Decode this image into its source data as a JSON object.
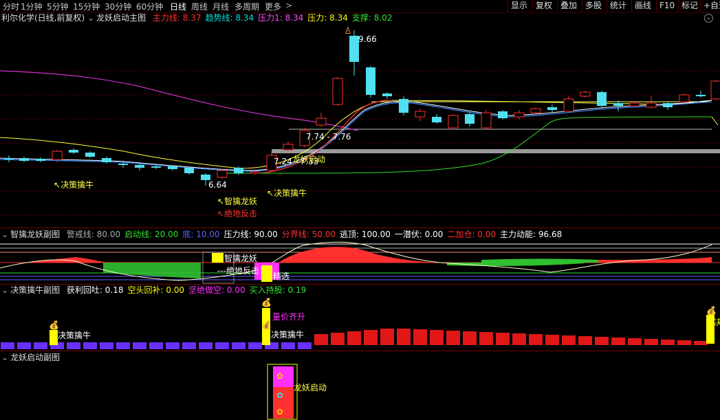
{
  "toolbar": {
    "periods": [
      "分时",
      "1分钟",
      "5分钟",
      "15分钟",
      "30分钟",
      "60分钟",
      "日线",
      "周线",
      "月线",
      "多周期",
      "更多"
    ],
    "active_period": "日线",
    "tools": [
      "显示",
      "复权",
      "叠加",
      "多股",
      "统计",
      "画线",
      "F10",
      "标记",
      "+自选"
    ]
  },
  "main": {
    "stock_title": "利尔化学(日线,前复权)",
    "indicator_name": "龙妖启动主图",
    "values": [
      {
        "label": "主力线:",
        "value": "8.37",
        "color": "#ff3030"
      },
      {
        "label": "趋势线:",
        "value": "8.34",
        "color": "#00e0e0"
      },
      {
        "label": "压力1:",
        "value": "8.34",
        "color": "#ff50ff"
      },
      {
        "label": "压力:",
        "value": "8.34",
        "color": "#ffff00"
      },
      {
        "label": "支撑:",
        "value": "8.02",
        "color": "#30e030"
      }
    ],
    "annotations": {
      "high": "9.66",
      "low": "6.64",
      "range": "7.74 - 7.76",
      "price_pair": "7.24 - 7.33",
      "longyao_qidong": "龙妖启动",
      "juece_1": "决策擒牛",
      "juece_2": "决策擒牛",
      "zhiqin": "智擒龙妖",
      "juedi": "绝地反击"
    }
  },
  "sub1": {
    "name": "智擒龙妖副图",
    "values": [
      {
        "label": "警戒线:",
        "value": "80.00",
        "color": "#aaaaaa"
      },
      {
        "label": "启动线:",
        "value": "20.00",
        "color": "#30e030"
      },
      {
        "label": "底:",
        "value": "10.00",
        "color": "#6060ff"
      },
      {
        "label": "压力线:",
        "value": "90.00",
        "color": "#ffffff"
      },
      {
        "label": "分界线:",
        "value": "50.00",
        "color": "#ff3030"
      },
      {
        "label": "逃顶:",
        "value": "100.00",
        "color": "#ffffff"
      },
      {
        "label": "一潜伏:",
        "value": "0.00",
        "color": "#ffffff"
      },
      {
        "label": "二加仓:",
        "value": "0.00",
        "color": "#ff3030"
      },
      {
        "label": "主力动能:",
        "value": "96.68",
        "color": "#ffffff"
      }
    ],
    "annotations": {
      "zhiqin": "智擒龙妖",
      "juedi": "---绝地反击",
      "jingbao": "精选"
    }
  },
  "sub2": {
    "name": "决策擒牛副图",
    "values": [
      {
        "label": "获利回吐:",
        "value": "0.18",
        "color": "#ffffff"
      },
      {
        "label": "空头回补:",
        "value": "0.00",
        "color": "#ffff00"
      },
      {
        "label": "坚绝做空:",
        "value": "0.00",
        "color": "#ff30ff"
      },
      {
        "label": "买入持股:",
        "value": "0.19",
        "color": "#30e030"
      }
    ],
    "annotations": {
      "juece_a": "决策擒牛",
      "juece_b": "决策擒牛",
      "liangjia": "量价齐升",
      "right_cut": "决"
    }
  },
  "sub3": {
    "name": "龙妖启动副图",
    "annotations": {
      "longyao": "龙妖启动"
    }
  },
  "colors": {
    "up": "#ff3030",
    "down": "#50e0f0",
    "bg": "#000000",
    "grid": "#7a0000"
  }
}
